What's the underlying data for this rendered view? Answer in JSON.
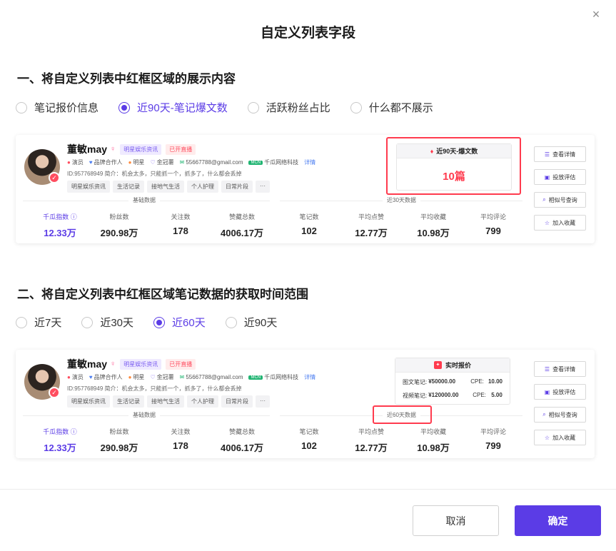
{
  "dialog": {
    "title": "自定义列表字段",
    "close_icon": "×",
    "cancel_label": "取消",
    "confirm_label": "确定"
  },
  "section1": {
    "title": "一、将自定义列表中红框区域的展示内容",
    "options": [
      "笔记报价信息",
      "近90天-笔记爆文数",
      "活跃粉丝占比",
      "什么都不展示"
    ],
    "selected_index": 1
  },
  "section2": {
    "title": "二、将自定义列表中红框区域笔记数据的获取时间范围",
    "options": [
      "近7天",
      "近30天",
      "近60天",
      "近90天"
    ],
    "selected_index": 2
  },
  "profile": {
    "name": "董敏may",
    "gender_icon": "♀",
    "tags": [
      "明星娱乐资讯",
      "已开直播"
    ],
    "meta": [
      {
        "icon": "●",
        "text": "演员"
      },
      {
        "icon": "♥",
        "text": "品牌合作人"
      },
      {
        "icon": "●",
        "text": "明星"
      },
      {
        "icon": "♡",
        "text": "金冠薯"
      },
      {
        "icon": "✉",
        "text": "55667788@gmail.com"
      }
    ],
    "mcn_badge": "MCN",
    "mcn_name": "千瓜网络科技",
    "detail_link": "详情",
    "bio": "ID:957768949   简介：机会太多，只能抓一个，抓多了，什么都会丢掉",
    "chips": [
      "明星娱乐资讯",
      "生活记录",
      "接地气生活",
      "个人护理",
      "日常片段",
      "···"
    ],
    "basic_label": "基础数据",
    "basic_stats": [
      {
        "label": "千瓜指数 ⓘ",
        "value": "12.33万"
      },
      {
        "label": "粉丝数",
        "value": "290.98万"
      },
      {
        "label": "关注数",
        "value": "178"
      },
      {
        "label": "赞藏总数",
        "value": "4006.17万"
      }
    ],
    "note_stats": [
      {
        "label": "笔记数",
        "value": "102"
      },
      {
        "label": "平均点赞",
        "value": "12.77万"
      },
      {
        "label": "平均收藏",
        "value": "10.98万"
      },
      {
        "label": "平均评论",
        "value": "799"
      }
    ],
    "actions": [
      {
        "icon": "☰",
        "label": "查看详情"
      },
      {
        "icon": "▣",
        "label": "投放评估"
      },
      {
        "icon": "⌕",
        "label": "相似号查询"
      },
      {
        "icon": "☆",
        "label": "加入收藏"
      }
    ]
  },
  "card1": {
    "period_label": "近30天数据",
    "hot_title": "近90天-爆文数",
    "hot_icon": "♦",
    "hot_value": "10篇"
  },
  "card2": {
    "period_label": "近60天数据",
    "price_title": "实时报价",
    "price_icon": "✦",
    "price_rows": [
      {
        "k": "图文笔记:",
        "v": "¥50000.00",
        "ck": "CPE:",
        "cv": "10.00"
      },
      {
        "k": "视频笔记:",
        "v": "¥120000.00",
        "ck": "CPE:",
        "cv": "5.00"
      }
    ]
  },
  "colors": {
    "accent": "#5b3ce6",
    "highlight_red": "#ff3b4e"
  }
}
